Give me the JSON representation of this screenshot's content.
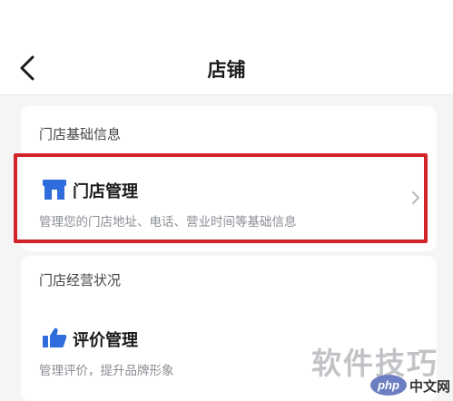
{
  "nav": {
    "title": "店铺"
  },
  "sections": [
    {
      "title": "门店基础信息",
      "item": {
        "icon": "store-icon",
        "title": "门店管理",
        "description": "管理您的门店地址、电话、营业时间等基础信息"
      }
    },
    {
      "title": "门店经营状况",
      "item": {
        "icon": "thumbs-up-icon",
        "title": "评价管理",
        "description": "管理评价，提升品牌形象"
      }
    }
  ],
  "watermark": {
    "text": "软件技巧",
    "badge": "php",
    "site": "中文网"
  },
  "colors": {
    "accent": "#2f6cdc",
    "highlight": "#d2242a"
  }
}
